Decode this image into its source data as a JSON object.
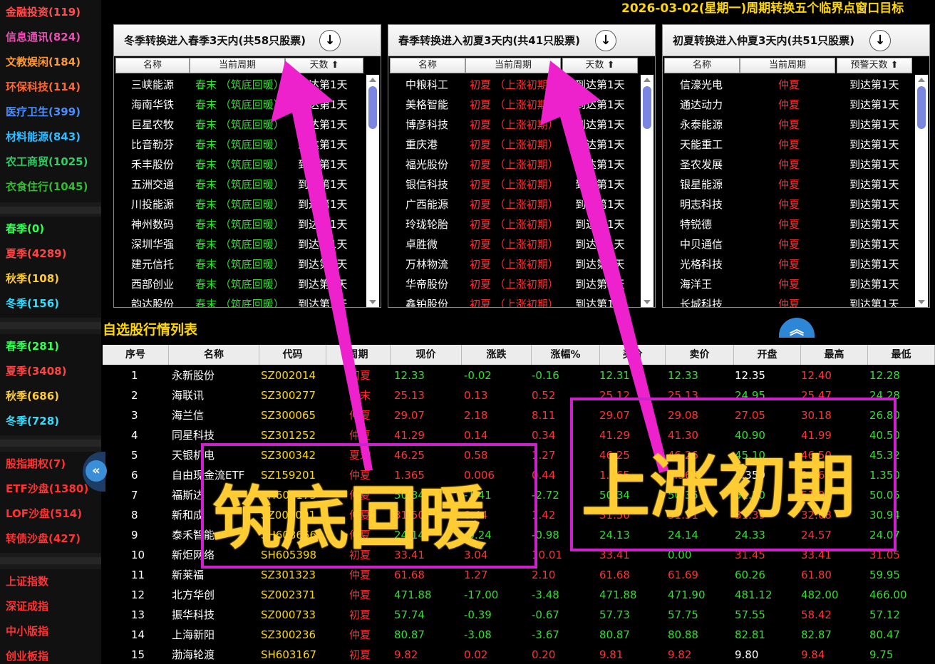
{
  "title": "2026-03-02(星期一)周期转换五个临界点窗口目标",
  "sidebar": {
    "group1": [
      {
        "label": "金融投资(119)",
        "color": "#ff4d4d"
      },
      {
        "label": "信息通讯(824)",
        "color": "#e94fb3"
      },
      {
        "label": "文教娱闲(184)",
        "color": "#ff9933"
      },
      {
        "label": "环保科技(114)",
        "color": "#ff6633"
      },
      {
        "label": "医疗卫生(399)",
        "color": "#4a8cff"
      },
      {
        "label": "材料能源(843)",
        "color": "#33bbff"
      },
      {
        "label": "农工商贸(1025)",
        "color": "#33cc66"
      },
      {
        "label": "衣食住行(1045)",
        "color": "#33bb33"
      }
    ],
    "group2": [
      {
        "label": "春季(0)",
        "color": "#33ff55"
      },
      {
        "label": "夏季(4289)",
        "color": "#ff4444"
      },
      {
        "label": "秋季(108)",
        "color": "#ffcc33"
      },
      {
        "label": "冬季(156)",
        "color": "#33ddff"
      }
    ],
    "group3": [
      {
        "label": "春季(281)",
        "color": "#33ff55"
      },
      {
        "label": "夏季(3408)",
        "color": "#ff4444"
      },
      {
        "label": "秋季(686)",
        "color": "#ffcc33"
      },
      {
        "label": "冬季(728)",
        "color": "#33ddff"
      }
    ],
    "group4": [
      {
        "label": "股指期权(7)",
        "color": "#ff3333"
      },
      {
        "label": "ETF沙盘(1380)",
        "color": "#ff3333"
      },
      {
        "label": "LOF沙盘(514)",
        "color": "#ff3333"
      },
      {
        "label": "转债沙盘(427)",
        "color": "#ff3333"
      }
    ],
    "group5": [
      {
        "label": "上证指数",
        "color": "#ff3333"
      },
      {
        "label": "深证成指",
        "color": "#ff3333"
      },
      {
        "label": "中小版指",
        "color": "#ff3333"
      },
      {
        "label": "创业板指",
        "color": "#ff3333"
      }
    ],
    "collapse_icon": "double-chevron-left-icon"
  },
  "panels": [
    {
      "title": "冬季转换进入春季3天内(共58只股票)",
      "cols": [
        "名称",
        "当前周期",
        "天数 ⬆"
      ],
      "rows": [
        [
          "三峡能源",
          "春末 （筑底回暖）",
          "到达第1天"
        ],
        [
          "海南华铁",
          "春末 （筑底回暖）",
          "到达第1天"
        ],
        [
          "巨星农牧",
          "春末 （筑底回暖）",
          "到达第1天"
        ],
        [
          "比音勒芬",
          "春末 （筑底回暖）",
          "到达第1天"
        ],
        [
          "禾丰股份",
          "春末 （筑底回暖）",
          "到达第1天"
        ],
        [
          "五洲交通",
          "春末 （筑底回暖）",
          "到达第1天"
        ],
        [
          "川投能源",
          "春末 （筑底回暖）",
          "到达第1天"
        ],
        [
          "神州数码",
          "春末 （筑底回暖）",
          "到达第1天"
        ],
        [
          "深圳华强",
          "春末 （筑底回暖）",
          "到达第1天"
        ],
        [
          "建元信托",
          "春末 （筑底回暖）",
          "到达第1天"
        ],
        [
          "西部创业",
          "春末 （筑底回暖）",
          "到达第1天"
        ],
        [
          "韵达股份",
          "春末 （筑底回暖）",
          "到达第1天"
        ]
      ],
      "status_color": "#33dd33"
    },
    {
      "title": "春季转换进入初夏3天内(共41只股票)",
      "cols": [
        "名称",
        "当前周期",
        "天数 ⬆"
      ],
      "rows": [
        [
          "中粮科工",
          "初夏 （上涨初期）",
          "到达第1天"
        ],
        [
          "美格智能",
          "初夏 （上涨初期）",
          "到达第1天"
        ],
        [
          "博彦科技",
          "初夏 （上涨初期）",
          "到达第1天"
        ],
        [
          "重庆港",
          "初夏 （上涨初期）",
          "到达第1天"
        ],
        [
          "福光股份",
          "初夏 （上涨初期）",
          "到达第1天"
        ],
        [
          "银信科技",
          "初夏 （上涨初期）",
          "到达第1天"
        ],
        [
          "广西能源",
          "初夏 （上涨初期）",
          "到达第1天"
        ],
        [
          "玲珑轮胎",
          "初夏 （上涨初期）",
          "到达第1天"
        ],
        [
          "卓胜微",
          "初夏 （上涨初期）",
          "到达第1天"
        ],
        [
          "万林物流",
          "初夏 （上涨初期）",
          "到达第1天"
        ],
        [
          "华帝股份",
          "初夏 （上涨初期）",
          "到达第1天"
        ],
        [
          "鑫铂股份",
          "初夏 （上涨初期）",
          "到达第1天"
        ]
      ],
      "status_color": "#ff3333"
    },
    {
      "title": "初夏转换进入仲夏3天内(共51只股票)",
      "cols": [
        "名称",
        "当前周期",
        "预警天数 ⬆"
      ],
      "rows": [
        [
          "信濠光电",
          "仲夏",
          "到达第1天"
        ],
        [
          "通达动力",
          "仲夏",
          "到达第1天"
        ],
        [
          "永泰能源",
          "仲夏",
          "到达第1天"
        ],
        [
          "天能重工",
          "仲夏",
          "到达第1天"
        ],
        [
          "圣农发展",
          "仲夏",
          "到达第1天"
        ],
        [
          "银星能源",
          "仲夏",
          "到达第1天"
        ],
        [
          "明志科技",
          "仲夏",
          "到达第1天"
        ],
        [
          "特锐德",
          "仲夏",
          "到达第1天"
        ],
        [
          "中贝通信",
          "仲夏",
          "到达第1天"
        ],
        [
          "光格科技",
          "仲夏",
          "到达第1天"
        ],
        [
          "海洋王",
          "仲夏",
          "到达第1天"
        ],
        [
          "长城科技",
          "仲夏",
          "到达第1天"
        ]
      ],
      "status_color": "#ff3333"
    }
  ],
  "watchlist": {
    "title": "自选股行情列表",
    "toggle_icon": "double-chevron-up-icon",
    "columns": [
      "序号",
      "名称",
      "代码",
      "周期",
      "现价",
      "涨跌",
      "涨幅%",
      "买价",
      "卖价",
      "开盘",
      "最高",
      "最低"
    ],
    "rows": [
      [
        "1",
        "永新股份",
        "SZ002014",
        "初夏",
        "12.33",
        "-0.02",
        "-0.16",
        "12.31",
        "12.33",
        "12.35",
        "12.40",
        "12.28"
      ],
      [
        "2",
        "海联讯",
        "SZ300277",
        "夏末",
        "25.13",
        "0.13",
        "0.52",
        "25.12",
        "25.13",
        "24.95",
        "25.47",
        "24.28"
      ],
      [
        "3",
        "海兰信",
        "SZ300065",
        "仲夏",
        "29.07",
        "2.18",
        "8.11",
        "29.07",
        "29.08",
        "27.05",
        "30.18",
        "26.80"
      ],
      [
        "4",
        "同星科技",
        "SZ301252",
        "仲夏",
        "41.29",
        "0.14",
        "0.34",
        "41.29",
        "41.30",
        "40.90",
        "41.99",
        "40.50"
      ],
      [
        "5",
        "天银机电",
        "SZ300342",
        "夏末",
        "46.25",
        "0.58",
        "1.27",
        "46.25",
        "46.26",
        "45.10",
        "46.50",
        "45.32"
      ],
      [
        "6",
        "自由现金流ETF",
        "SZ159201",
        "仲夏",
        "1.365",
        "0.006",
        "0.44",
        "1.365",
        "1.366",
        "1.359",
        "1.368",
        "1.350"
      ],
      [
        "7",
        "福斯达",
        "SH603173",
        "仲夏",
        "50.34",
        "-1.41",
        "-2.72",
        "50.34",
        "50.35",
        "51.50",
        "51.90",
        "50.05"
      ],
      [
        "8",
        "新和成",
        "SZ002001",
        "仲夏",
        "31.50",
        "0.44",
        "1.42",
        "31.50",
        "31.51",
        "31.39",
        "32.08",
        "30.94"
      ],
      [
        "9",
        "泰禾智能",
        "SH603656",
        "仲夏",
        "24.14",
        "-0.24",
        "-0.98",
        "24.13",
        "24.14",
        "24.33",
        "24.57",
        "24.07"
      ],
      [
        "10",
        "新炬网络",
        "SH605398",
        "初夏",
        "33.41",
        "3.04",
        "10.01",
        "33.41",
        "0.00",
        "31.45",
        "33.41",
        "31.05"
      ],
      [
        "11",
        "新莱福",
        "SZ301323",
        "仲夏",
        "61.68",
        "1.27",
        "2.10",
        "61.68",
        "61.69",
        "60.26",
        "61.80",
        "59.95"
      ],
      [
        "12",
        "北方华创",
        "SZ002371",
        "仲夏",
        "471.88",
        "-17.00",
        "-3.48",
        "471.88",
        "471.90",
        "481.12",
        "482.00",
        "466.00"
      ],
      [
        "13",
        "振华科技",
        "SZ000733",
        "初夏",
        "57.74",
        "-0.39",
        "-0.67",
        "57.73",
        "57.75",
        "57.55",
        "58.42",
        "57.12"
      ],
      [
        "14",
        "上海新阳",
        "SZ300236",
        "仲夏",
        "80.87",
        "-3.08",
        "-3.67",
        "80.87",
        "80.88",
        "82.81",
        "82.87",
        "80.47"
      ],
      [
        "15",
        "渤海轮渡",
        "SH603167",
        "初夏",
        "9.82",
        "0.02",
        "0.20",
        "9.81",
        "9.82",
        "9.80",
        "9.84",
        "9.75"
      ]
    ]
  },
  "annotations": {
    "label_left": "筑底回暖",
    "label_right": "上涨初期",
    "arrow_color": "#ee22cc",
    "box_color": "#cc22cc",
    "label_color": "#ffcc33"
  }
}
